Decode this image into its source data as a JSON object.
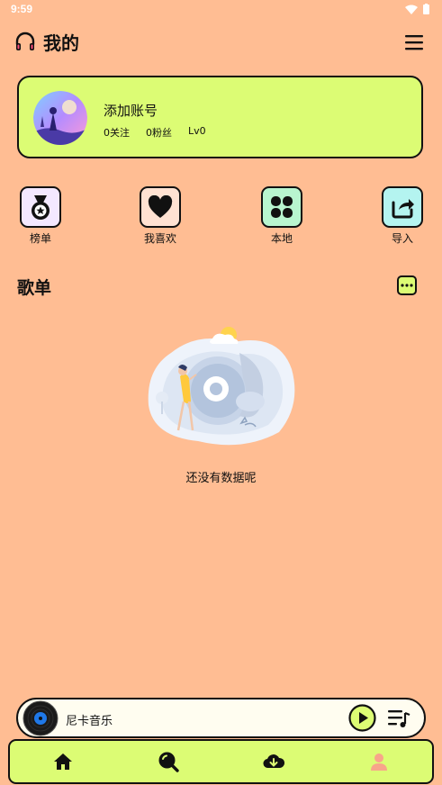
{
  "status_bar": {
    "time": "9:59"
  },
  "header": {
    "title": "我的",
    "icon": "headphones-icon",
    "menu_icon": "hamburger-menu-icon"
  },
  "account": {
    "name": "添加账号",
    "following": "0关注",
    "fans": "0粉丝",
    "level": "Lv0"
  },
  "quick_actions": [
    {
      "label": "榜单",
      "icon": "medal-icon",
      "color": "#f3e8ff"
    },
    {
      "label": "我喜欢",
      "icon": "heart-icon",
      "color": "#ffe2d2"
    },
    {
      "label": "本地",
      "icon": "grid-icon",
      "color": "#b8f5cf"
    },
    {
      "label": "导入",
      "icon": "import-share-icon",
      "color": "#b4f4f0"
    }
  ],
  "playlist_section": {
    "title": "歌单",
    "more_icon": "more-dots-icon"
  },
  "empty_state": {
    "text": "还没有数据呢"
  },
  "player": {
    "title": "尼卡音乐"
  },
  "bottom_nav": [
    {
      "icon": "home-icon"
    },
    {
      "icon": "search-icon"
    },
    {
      "icon": "cloud-download-icon"
    },
    {
      "icon": "profile-icon",
      "active": true
    }
  ],
  "colors": {
    "background": "#ffbd93",
    "accent": "#dcfc74",
    "active_nav": "#f8a58a"
  }
}
